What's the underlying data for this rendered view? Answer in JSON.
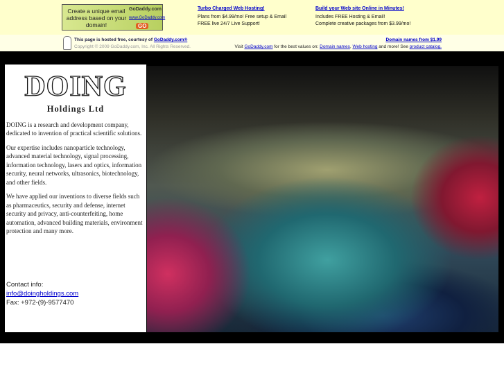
{
  "banner": {
    "ad": {
      "text": "Create a unique email address based on your domain!",
      "brand": "GoDaddy.com",
      "url": "www.GoDaddy.com",
      "go": "GO"
    },
    "col1": {
      "title": "Turbo Charged Web Hosting!",
      "line1": "Plans from $4.99/mo! Free setup & Email",
      "line2": "FREE live 24/7 Live Support!"
    },
    "col2": {
      "title": "Build your Web site Online in Minutes!",
      "line1": "Includes FREE Hosting & Email!",
      "line2": "Complete creative packages from $3.99/mo!"
    },
    "hosted_prefix": "This page is hosted free, courtesy of ",
    "hosted_link": "GoDaddy.com®",
    "copyright": "Copyright © 2009 GoDaddy.com, Inc. All Rights Reserved.",
    "domain_link": "Domain names from $1.99",
    "visit_prefix": "Visit ",
    "visit_link": "GoDaddy.com",
    "visit_mid": " for the best values on: ",
    "link_domains": "Domain names",
    "sep": ", ",
    "link_hosting": "Web hosting",
    "visit_more": " and more! See ",
    "link_catalog": "product catalog."
  },
  "company": {
    "logo": "DOING",
    "subtitle": "Holdings Ltd",
    "paragraphs": [
      "DOING is a research and development company, dedicated to invention of practical scientific solutions.",
      "Our expertise includes nanoparticle technology, advanced material technology, signal processing, information technology, lasers and optics, information security, neural networks, ultrasonics, biotechnology, and other fields.",
      "We have applied our inventions to diverse fields such as pharmaceutics, security and defense, internet security and privacy, anti-counterfeiting, home automation, advanced building materials, environment protection and many more."
    ],
    "contact_label": "Contact info:",
    "email": "info@doingholdings.com",
    "fax": "Fax: +972-(9)-9577470"
  }
}
